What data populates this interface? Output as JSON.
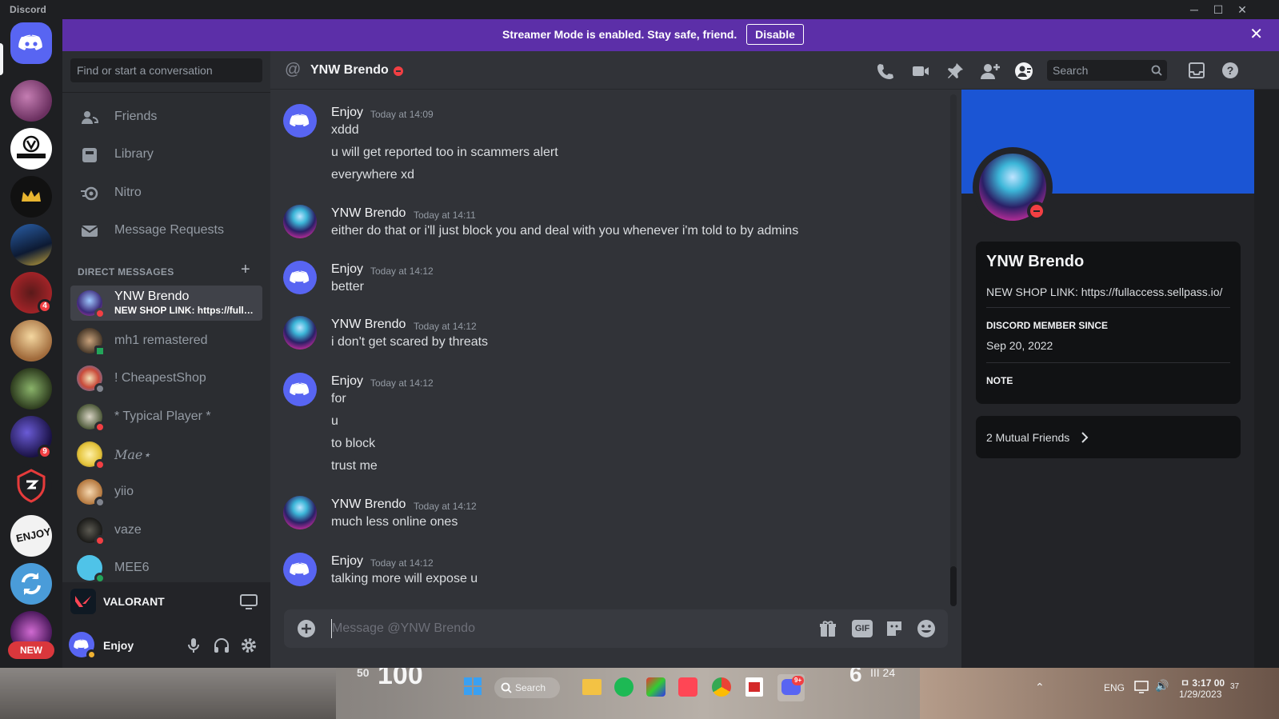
{
  "window": {
    "brand": "Discord",
    "minimize": "─",
    "maximize": "☐",
    "close": "✕"
  },
  "rail": {
    "badges": [
      "4",
      "9"
    ],
    "new_label": "NEW"
  },
  "banner": {
    "message": "Streamer Mode is enabled. Stay safe, friend.",
    "button": "Disable"
  },
  "sidebar": {
    "search_placeholder": "Find or start a conversation",
    "nav": [
      "Friends",
      "Library",
      "Nitro",
      "Message Requests"
    ],
    "dm_header": "DIRECT MESSAGES",
    "dms": [
      {
        "name": "YNW Brendo",
        "sub": "NEW SHOP LINK: https://fullaccess.sellpass.io/",
        "status": "dnd",
        "active": true
      },
      {
        "name": "mh1 remastered",
        "status": "mobile"
      },
      {
        "name": "! CheapestShop",
        "status": "offline"
      },
      {
        "name": "* Typical Player *",
        "status": "dnd"
      },
      {
        "name": "𝑀𝑎𝑒⋆",
        "status": "dnd"
      },
      {
        "name": "yiio",
        "status": "offline"
      },
      {
        "name": "vaze",
        "status": "dnd"
      },
      {
        "name": "MEE6",
        "status": "online"
      }
    ],
    "activity": "VALORANT",
    "user": "Enjoy"
  },
  "chat": {
    "title": "YNW Brendo",
    "search_placeholder": "Search",
    "composer_placeholder": "Message @YNW Brendo",
    "groups": [
      {
        "author": "Enjoy",
        "time": "Today at 14:09",
        "lines": [
          "xddd",
          "u will get reported too in scammers alert",
          "everywhere xd"
        ]
      },
      {
        "author": "YNW Brendo",
        "time": "Today at 14:11",
        "lines": [
          "either do that or i'll just block you and deal with you whenever i'm told to by admins"
        ]
      },
      {
        "author": "Enjoy",
        "time": "Today at 14:12",
        "lines": [
          "better"
        ]
      },
      {
        "author": "YNW Brendo",
        "time": "Today at 14:12",
        "lines": [
          "i don't get scared by threats"
        ]
      },
      {
        "author": "Enjoy",
        "time": "Today at 14:12",
        "lines": [
          "for",
          "u",
          "to block",
          "trust me"
        ]
      },
      {
        "author": "YNW Brendo",
        "time": "Today at 14:12",
        "lines": [
          "much less online ones"
        ]
      },
      {
        "author": "Enjoy",
        "time": "Today at 14:12",
        "lines": [
          "talking more will expose u"
        ]
      }
    ],
    "gif_label": "GIF"
  },
  "profile": {
    "name": "YNW Brendo",
    "bio": "NEW SHOP LINK: https://fullaccess.sellpass.io/",
    "member_since_label": "DISCORD MEMBER SINCE",
    "member_since": "Sep 20, 2022",
    "note_label": "NOTE",
    "mutual": "2 Mutual Friends"
  },
  "taskbar": {
    "hud_left": "50",
    "hud_big": "100",
    "search": "Search",
    "hud_right": "6",
    "hud_right_small": "III 24",
    "lang": "ENG",
    "time": "ㅁ 3:17 00",
    "date": "1/29/2023",
    "notif": "37",
    "discord_badge": "9+"
  },
  "colors": {
    "blurple": "#5865f2",
    "dnd": "#f23f43",
    "online": "#23a55a",
    "offline": "#80848e",
    "banner": "#5c2fa8",
    "profile_banner": "#1b55d4"
  }
}
